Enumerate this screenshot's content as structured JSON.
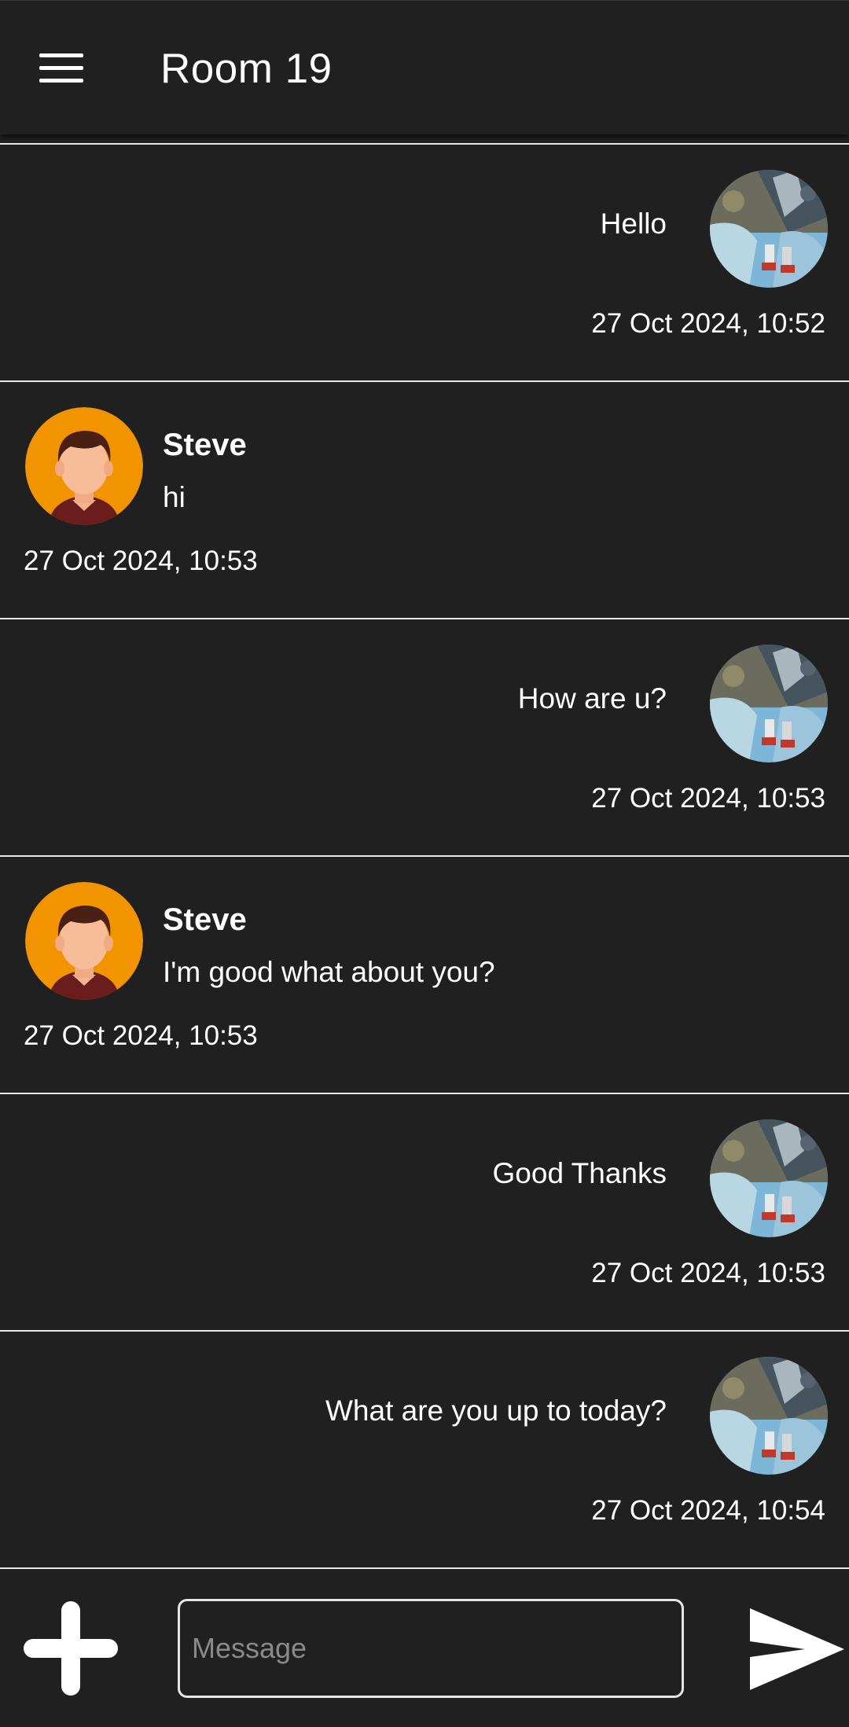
{
  "header": {
    "title": "Room 19",
    "menu_icon": "hamburger-menu-icon"
  },
  "messages": [
    {
      "side": "mine",
      "text": "Hello",
      "time": "27 Oct 2024, 10:52"
    },
    {
      "side": "theirs",
      "sender": "Steve",
      "text": "hi",
      "time": "27 Oct 2024, 10:53"
    },
    {
      "side": "mine",
      "text": "How are u?",
      "time": "27 Oct 2024, 10:53"
    },
    {
      "side": "theirs",
      "sender": "Steve",
      "text": "I'm good what about you?",
      "time": "27 Oct 2024, 10:53"
    },
    {
      "side": "mine",
      "text": "Good Thanks",
      "time": "27 Oct 2024, 10:53"
    },
    {
      "side": "mine",
      "text": "What are you up to today?",
      "time": "27 Oct 2024, 10:54"
    }
  ],
  "composer": {
    "placeholder": "Message",
    "value": "",
    "add_icon": "plus-icon",
    "send_icon": "send-icon"
  },
  "colors": {
    "background": "#202020",
    "text": "#ffffff",
    "divider": "#e8e8e8",
    "avatar_orange": "#F29400"
  }
}
